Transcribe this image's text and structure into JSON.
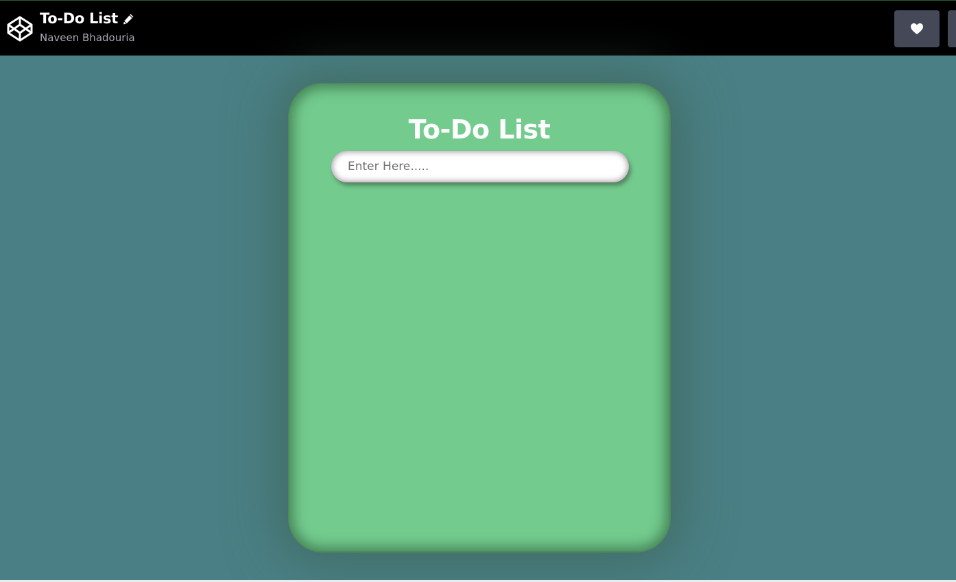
{
  "header": {
    "logo_icon": "codepen-logo-icon",
    "pen_title": "To-Do List",
    "edit_icon": "pencil-icon",
    "author": "Naveen Bhadouria",
    "heart_icon": "heart-icon"
  },
  "app": {
    "title": "To-Do List",
    "input_placeholder": "Enter Here.....",
    "input_value": ""
  },
  "colors": {
    "background": "#4a8085",
    "card": "#73cb8e",
    "topbar": "#000000",
    "button": "#444857"
  }
}
